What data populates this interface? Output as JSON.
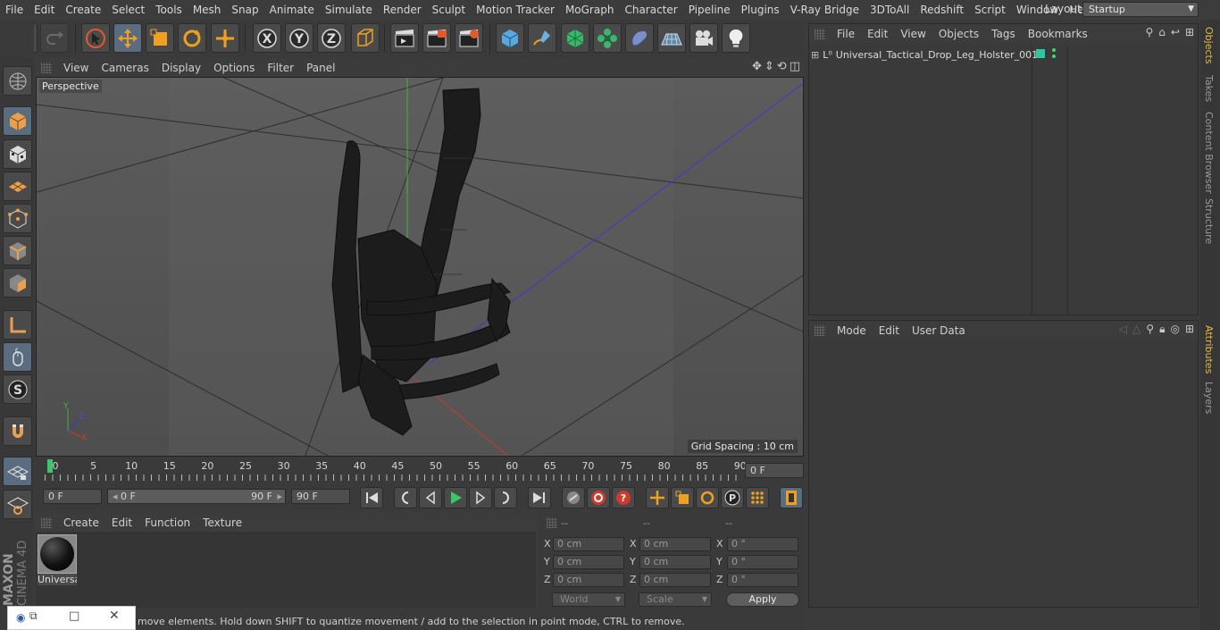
{
  "menubar": {
    "items": [
      "File",
      "Edit",
      "Create",
      "Select",
      "Tools",
      "Mesh",
      "Snap",
      "Animate",
      "Simulate",
      "Render",
      "Sculpt",
      "Motion Tracker",
      "MoGraph",
      "Character",
      "Pipeline",
      "Plugins",
      "V-Ray Bridge",
      "3DToAll",
      "Redshift",
      "Script",
      "Window",
      "Help"
    ],
    "layout_label": "Layout:",
    "layout_value": "Startup"
  },
  "viewport": {
    "menu": [
      "View",
      "Cameras",
      "Display",
      "Options",
      "Filter",
      "Panel"
    ],
    "label": "Perspective",
    "grid_spacing": "Grid Spacing : 10 cm"
  },
  "timeline": {
    "ticks": [
      "0",
      "5",
      "10",
      "15",
      "20",
      "25",
      "30",
      "35",
      "40",
      "45",
      "50",
      "55",
      "60",
      "65",
      "70",
      "75",
      "80",
      "85",
      "90"
    ],
    "current_frame": "0 F"
  },
  "transport": {
    "start_field": "0 F",
    "range_start": "0 F",
    "range_end": "90 F",
    "end_field": "90 F"
  },
  "material_manager": {
    "menu": [
      "Create",
      "Edit",
      "Function",
      "Texture"
    ],
    "material_name": "Universa"
  },
  "coordinates": {
    "headers": [
      "--",
      "--",
      "--"
    ],
    "rows": [
      {
        "axis": "X",
        "pos": "0 cm",
        "size": "0 cm",
        "rot_axis": "X",
        "rot": "0 °"
      },
      {
        "axis": "Y",
        "pos": "0 cm",
        "size": "0 cm",
        "rot_axis": "Y",
        "rot": "0 °"
      },
      {
        "axis": "Z",
        "pos": "0 cm",
        "size": "0 cm",
        "rot_axis": "Z",
        "rot": "0 °"
      }
    ],
    "world": "World",
    "scale": "Scale",
    "apply": "Apply"
  },
  "status": "move elements. Hold down SHIFT to quantize movement / add to the selection in point mode, CTRL to remove.",
  "objects_panel": {
    "menu": [
      "File",
      "Edit",
      "View",
      "Objects",
      "Tags",
      "Bookmarks"
    ],
    "object_name": "Universal_Tactical_Drop_Leg_Holster_001"
  },
  "attributes_panel": {
    "menu": [
      "Mode",
      "Edit",
      "User Data"
    ]
  },
  "right_tabs": [
    "Objects",
    "Takes",
    "Content Browser",
    "Structure",
    "Attributes",
    "Layers"
  ],
  "branding": {
    "vendor": "MAXON",
    "product": "CINEMA 4D"
  },
  "colors": {
    "accent": "#5a6c80",
    "active_tab": "#e6b84b",
    "axis_x": "#c83a2a",
    "axis_y": "#3cc83c",
    "axis_z": "#3a3ad0"
  }
}
